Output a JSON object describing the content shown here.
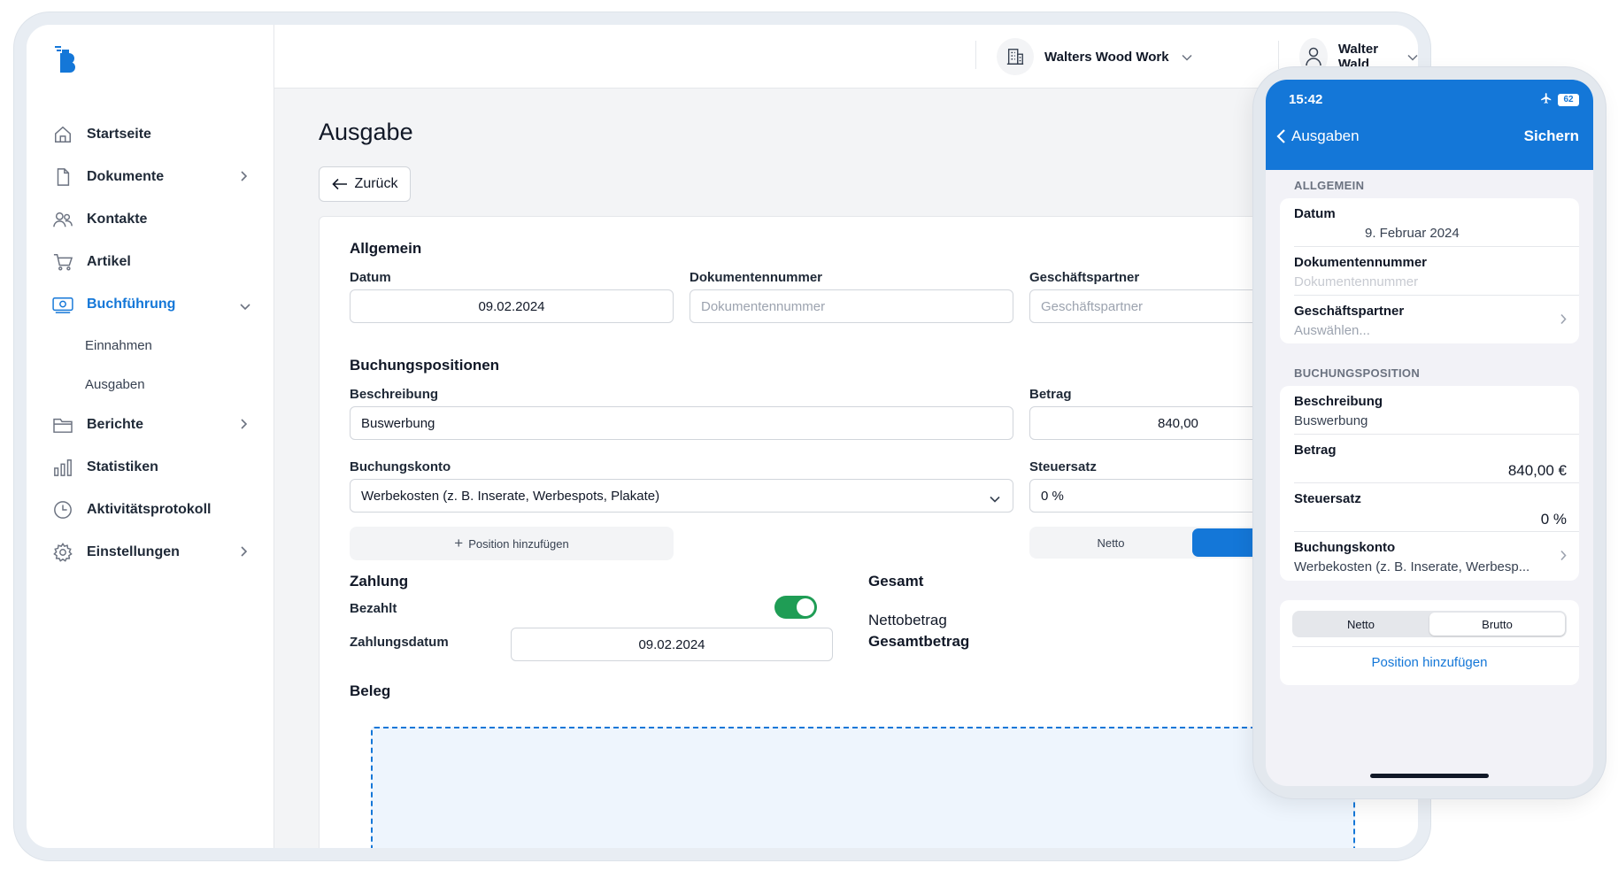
{
  "topbar": {
    "company": "Walters Wood Work",
    "user": "Walter Wald"
  },
  "sidebar": {
    "items": [
      {
        "label": "Startseite",
        "icon": "home-icon"
      },
      {
        "label": "Dokumente",
        "icon": "document-icon"
      },
      {
        "label": "Kontakte",
        "icon": "contacts-icon"
      },
      {
        "label": "Artikel",
        "icon": "cart-icon"
      },
      {
        "label": "Buchführung",
        "icon": "money-icon"
      },
      {
        "label": "Berichte",
        "icon": "folder-icon"
      },
      {
        "label": "Statistiken",
        "icon": "chart-icon"
      },
      {
        "label": "Aktivitätsprotokoll",
        "icon": "clock-icon"
      },
      {
        "label": "Einstellungen",
        "icon": "gear-icon"
      }
    ],
    "sub_items": [
      "Einnahmen",
      "Ausgaben"
    ]
  },
  "main": {
    "title": "Ausgabe",
    "back_label": "Zurück",
    "general": {
      "title": "Allgemein",
      "date_label": "Datum",
      "date_value": "09.02.2024",
      "docnum_label": "Dokumentennummer",
      "docnum_placeholder": "Dokumentennummer",
      "partner_label": "Geschäftspartner",
      "partner_placeholder": "Geschäftspartner"
    },
    "positions": {
      "title": "Buchungspositionen",
      "desc_label": "Beschreibung",
      "desc_value": "Buswerbung",
      "amount_label": "Betrag",
      "amount_value": "840,00",
      "account_label": "Buchungskonto",
      "account_value": "Werbekosten (z. B. Inserate, Werbespots, Plakate)",
      "tax_label": "Steuersatz",
      "tax_value": "0 %",
      "add_label": "Position hinzufügen",
      "netto_label": "Netto"
    },
    "payment": {
      "title": "Zahlung",
      "paid_label": "Bezahlt",
      "paid": true,
      "date_label": "Zahlungsdatum",
      "date_value": "09.02.2024"
    },
    "total": {
      "title": "Gesamt",
      "net_label": "Nettobetrag",
      "gross_label": "Gesamtbetrag"
    },
    "receipt": {
      "title": "Beleg"
    }
  },
  "phone": {
    "time": "15:42",
    "battery": "62",
    "back_label": "Ausgaben",
    "save_label": "Sichern",
    "general": {
      "title": "ALLGEMEIN",
      "date_label": "Datum",
      "date_value": "9. Februar 2024",
      "docnum_label": "Dokumentennummer",
      "docnum_placeholder": "Dokumentennummer",
      "partner_label": "Geschäftspartner",
      "partner_placeholder": "Auswählen..."
    },
    "position": {
      "title": "BUCHUNGSPOSITION",
      "desc_label": "Beschreibung",
      "desc_value": "Buswerbung",
      "amount_label": "Betrag",
      "amount_value": "840,00 €",
      "tax_label": "Steuersatz",
      "tax_value": "0 %",
      "account_label": "Buchungskonto",
      "account_value": "Werbekosten (z. B. Inserate, Werbesp..."
    },
    "segment": {
      "netto": "Netto",
      "brutto": "Brutto"
    },
    "add_label": "Position hinzufügen"
  },
  "colors": {
    "accent": "#1477d8",
    "toggle_on": "#1f9d55"
  }
}
